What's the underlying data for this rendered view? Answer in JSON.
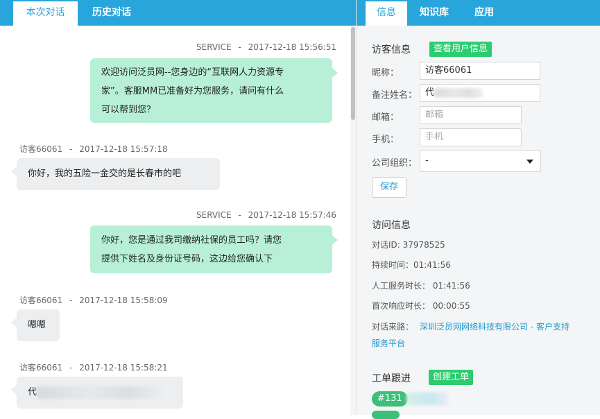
{
  "left_tabs": {
    "current": "本次对话",
    "history": "历史对话"
  },
  "messages": [
    {
      "sender": "SERVICE",
      "sep": "-",
      "time": "2017-12-18 15:56:51",
      "lines": [
        "欢迎访问泛员网--您身边的“互联网人力资源专",
        "家”。客服MM已准备好为您服务，请问有什么",
        "可以帮到您？"
      ]
    },
    {
      "sender": "访客66061",
      "sep": "-",
      "time": "2017-12-18 15:57:18",
      "lines": [
        "你好，我的五险一金交的是长春市的吧"
      ]
    },
    {
      "sender": "SERVICE",
      "sep": "-",
      "time": "2017-12-18 15:57:46",
      "lines": [
        "你好，您是通过我司缴纳社保的员工吗？请您",
        "提供下姓名及身份证号码，这边给您确认下"
      ]
    },
    {
      "sender": "访客66061",
      "sep": "-",
      "time": "2017-12-18 15:58:09",
      "lines": [
        "嗯嗯"
      ]
    },
    {
      "sender": "访客66061",
      "sep": "-",
      "time": "2017-12-18 15:58:21",
      "lines": [
        "代"
      ]
    }
  ],
  "right_tabs": {
    "info": "信息",
    "kb": "知识库",
    "apps": "应用"
  },
  "visitor": {
    "title": "访客信息",
    "view_button": "查看用户信息",
    "nickname_label": "昵称：",
    "nickname_value": "访客66061",
    "remark_label": "备注姓名：",
    "remark_value": "代",
    "email_label": "邮箱：",
    "email_placeholder": "邮箱",
    "phone_label": "手机：",
    "phone_placeholder": "手机",
    "company_label": "公司组织：",
    "company_value": "-",
    "save_button": "保存"
  },
  "visit": {
    "title": "访问信息",
    "session_id": "对话ID: 37978525",
    "duration": "持续时间：01:41:56",
    "manual_duration": "人工服务时长： 01:41:56",
    "first_response": "首次响应时长： 00:00:55",
    "source_label": "对话来路：",
    "source_line1": "深圳泛员网网络科技有限公司 - 客户支持",
    "source_line2": "服务平台"
  },
  "ticket": {
    "title": "工单跟进",
    "create_button": "创建工单",
    "tag": "#131"
  },
  "colors": {
    "header": "#28a6dc",
    "service_bubble": "#b7f0d6",
    "visitor_bubble": "#eceef0",
    "green_button": "#2ecc71",
    "link": "#1d9ad0"
  }
}
